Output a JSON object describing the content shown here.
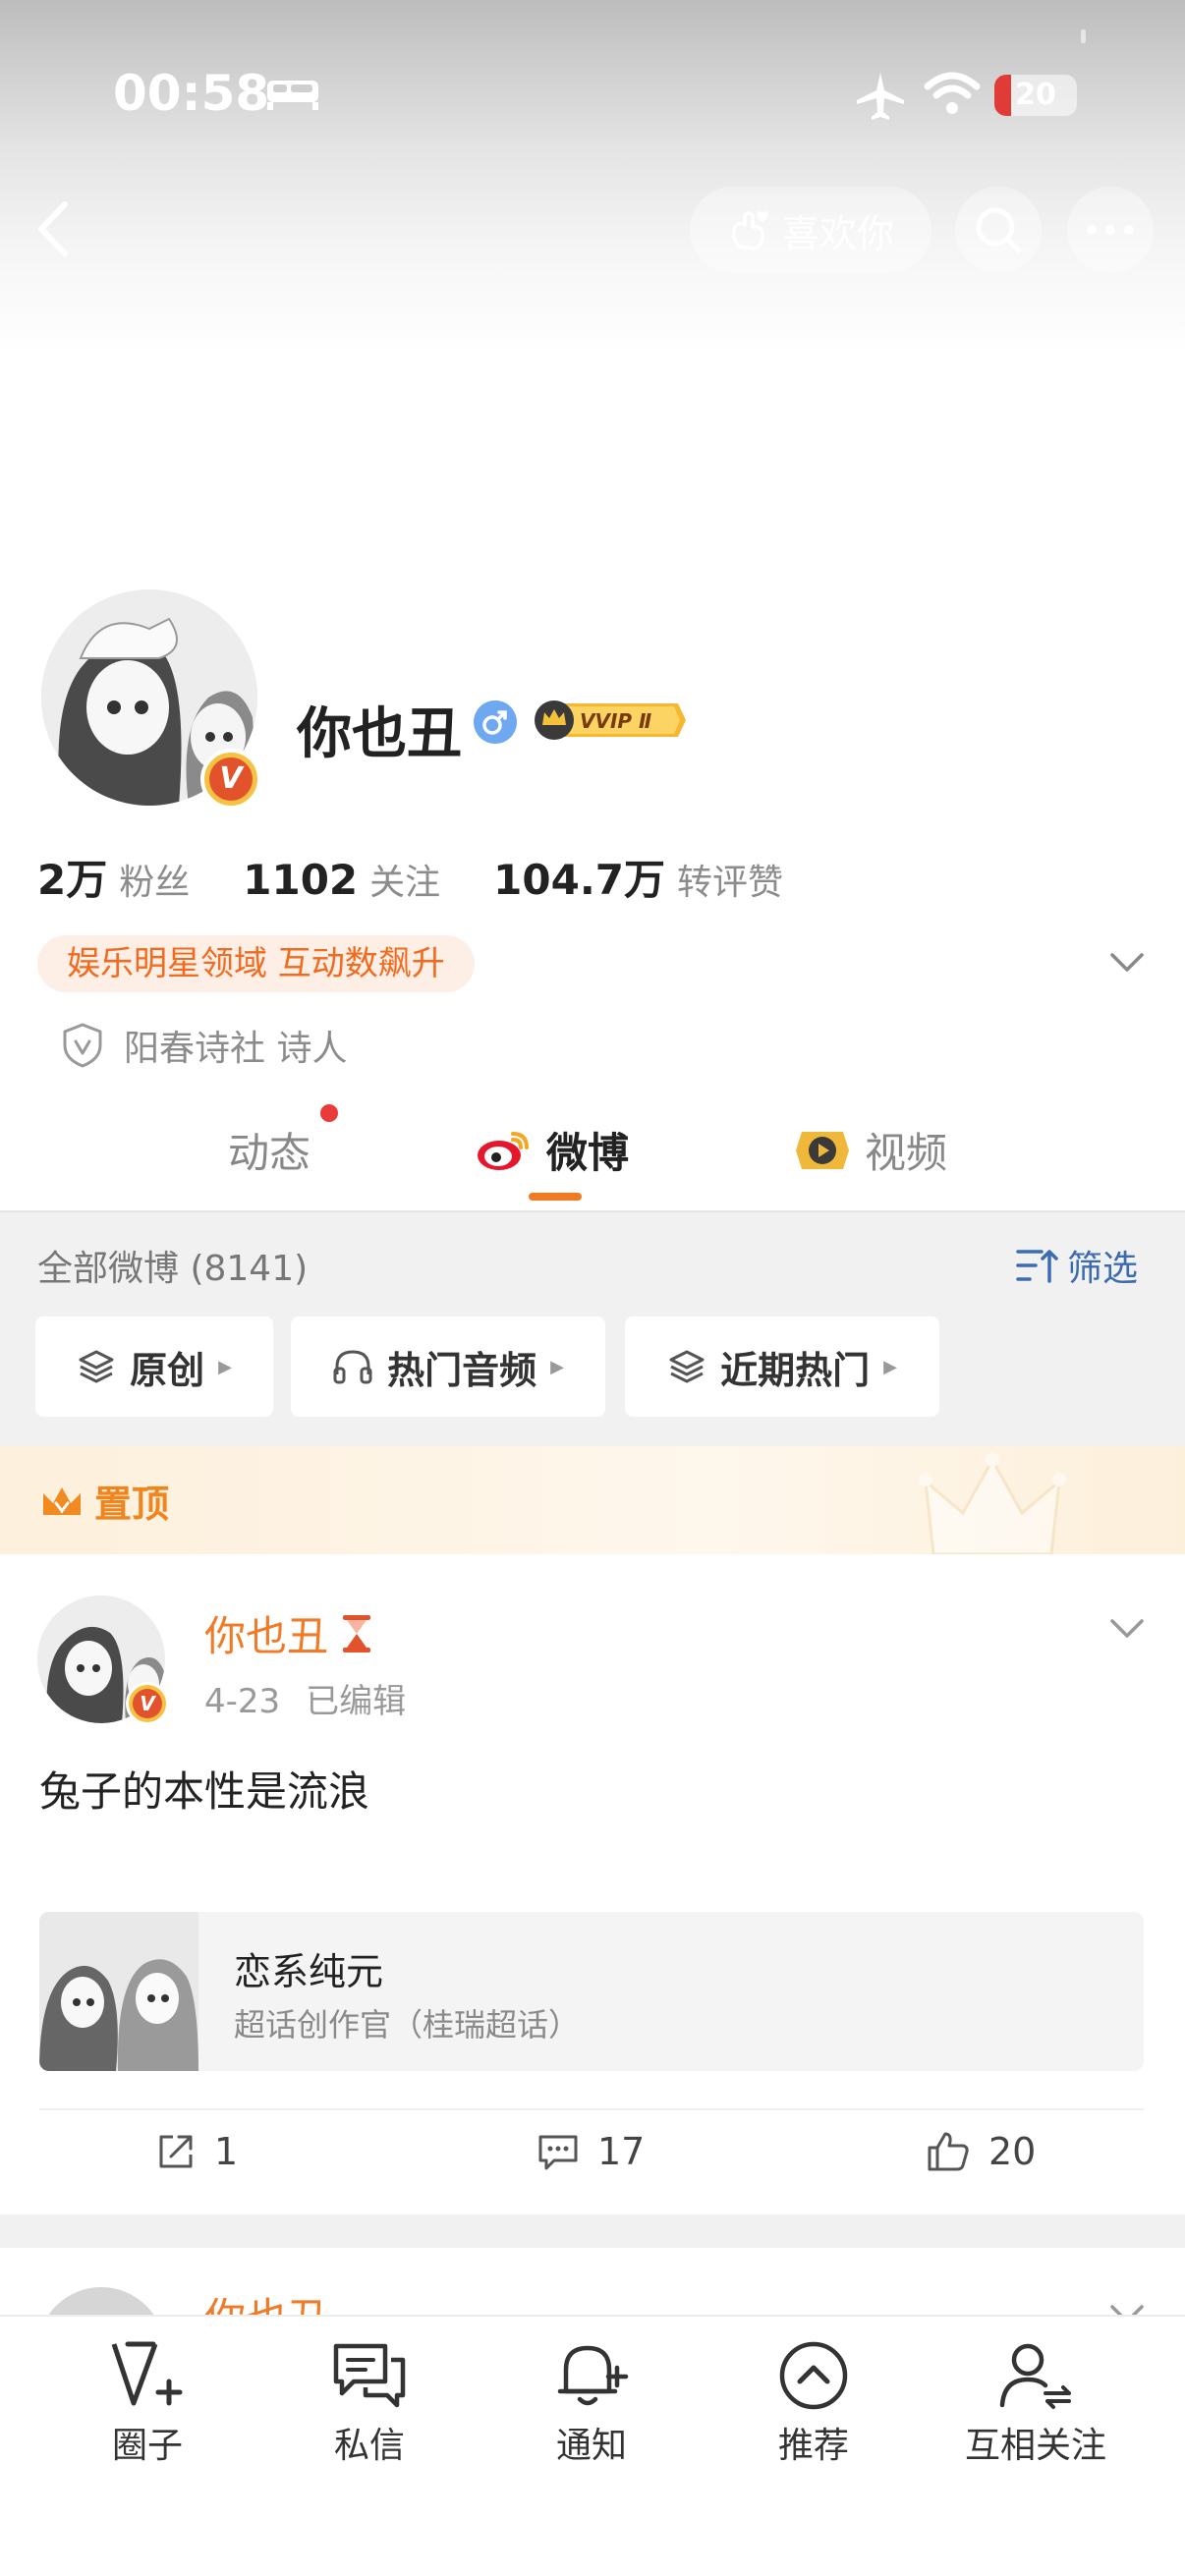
{
  "status_bar": {
    "time": "00:58",
    "battery": "20",
    "battery_level": 0.2
  },
  "header": {
    "like_button_label": "喜欢你"
  },
  "profile": {
    "name": "你也丑",
    "badge_v": "V",
    "vip_label": "VVIP Ⅱ",
    "stats": [
      {
        "value": "2万",
        "label": "粉丝"
      },
      {
        "value": "1102",
        "label": "关注"
      },
      {
        "value": "104.7万",
        "label": "转评赞"
      }
    ],
    "tag": "娱乐明星领域 互动数飙升",
    "verification": "阳春诗社 诗人"
  },
  "tabs": [
    {
      "label": "动态"
    },
    {
      "label": "微博"
    },
    {
      "label": "视频"
    }
  ],
  "feed_filter": {
    "all_count": "全部微博 (8141)",
    "filter_label": "筛选",
    "chips": [
      {
        "label": "原创"
      },
      {
        "label": "热门音频"
      },
      {
        "label": "近期热门"
      }
    ]
  },
  "pinned": {
    "label": "置顶"
  },
  "post": {
    "user": "你也丑",
    "date": "4-23",
    "edited": "已编辑",
    "text": "兔子的本性是流浪",
    "card": {
      "title": "恋系纯元",
      "subtitle": "超话创作官（桂瑞超话）"
    },
    "reposts": "1",
    "comments": "17",
    "likes": "20"
  },
  "next_post_peek": {
    "user": "你也丑"
  },
  "tab_bar": [
    {
      "label": "圈子"
    },
    {
      "label": "私信"
    },
    {
      "label": "通知"
    },
    {
      "label": "推荐"
    },
    {
      "label": "互相关注"
    }
  ],
  "colors": {
    "accent_orange": "#f27b21",
    "link_blue": "#3c6cb0",
    "badge_red": "#e2522b"
  }
}
